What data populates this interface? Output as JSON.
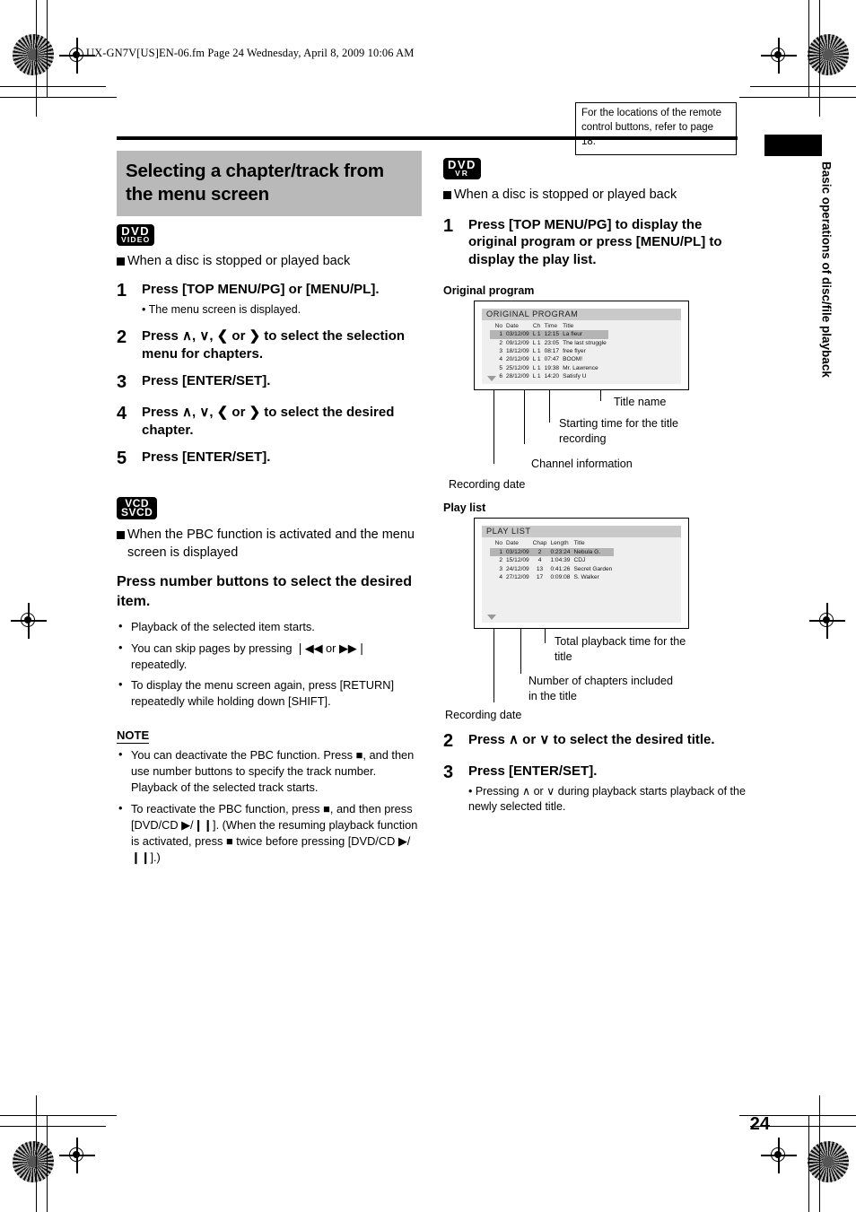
{
  "page": {
    "file_header": "UX-GN7V[US]EN-06.fm  Page 24  Wednesday, April 8, 2009  10:06 AM",
    "page_number": "24",
    "side_tab_label": "Basic operations of disc/file playback",
    "reference_note": "For the locations of the remote control buttons, refer to page 18."
  },
  "left_column": {
    "section_title": "Selecting a chapter/track from the menu screen",
    "dvd_badge": {
      "line1": "DVD",
      "line2": "VIDEO"
    },
    "condition": "When a disc is stopped or played back",
    "steps": [
      {
        "num": "1",
        "text": "Press [TOP MENU/PG] or [MENU/PL].",
        "sub": "• The menu screen is displayed."
      },
      {
        "num": "2",
        "text": "Press ∧, ∨, ❮ or ❯ to select the selection menu for chapters.",
        "sub": ""
      },
      {
        "num": "3",
        "text": "Press [ENTER/SET].",
        "sub": ""
      },
      {
        "num": "4",
        "text": "Press ∧, ∨, ❮ or ❯ to select the desired chapter.",
        "sub": ""
      },
      {
        "num": "5",
        "text": "Press [ENTER/SET].",
        "sub": ""
      }
    ],
    "vcd_badge": {
      "line1": "VCD",
      "line2": "SVCD"
    },
    "pbc_condition": "When the PBC function is activated and the menu screen is displayed",
    "pbc_instruction": "Press number buttons to select the desired item.",
    "pbc_bullets": [
      "Playback of the selected item starts.",
      "You can skip pages by pressing ❘◀◀ or ▶▶❘ repeatedly.",
      "To display the menu screen again, press [RETURN] repeatedly while holding down [SHIFT]."
    ],
    "note_header": "NOTE",
    "note_bullets": [
      "You can deactivate the PBC function. Press ■, and then use number buttons to specify the track number. Playback of the selected track starts.",
      "To reactivate the PBC function, press ■, and then press [DVD/CD ▶/❙❙]. (When the resuming playback function is activated, press ■ twice before pressing [DVD/CD ▶/❙❙].)"
    ]
  },
  "right_column": {
    "dvd_vr_badge": {
      "line1": "DVD",
      "line2": "VR"
    },
    "condition": "When a disc is stopped or played back",
    "steps": [
      {
        "num": "1",
        "text": "Press [TOP MENU/PG] to display the original program or press [MENU/PL] to display the play list.",
        "sub": ""
      },
      {
        "num": "2",
        "text": "Press ∧ or ∨ to select the desired title.",
        "sub": ""
      },
      {
        "num": "3",
        "text": "Press [ENTER/SET].",
        "sub": "• Pressing ∧ or ∨ during playback starts playback of the newly selected title."
      }
    ],
    "original_program": {
      "caption": "Original program",
      "osd_title": "ORIGINAL PROGRAM",
      "columns": [
        "No",
        "Date",
        "Ch",
        "Time",
        "Title"
      ],
      "rows": [
        {
          "no": "1",
          "date": "03/12/09",
          "ch": "L  1",
          "time": "12:15",
          "title": "La fleur",
          "selected": true
        },
        {
          "no": "2",
          "date": "09/12/09",
          "ch": "L  1",
          "time": "23:05",
          "title": "The last struggle",
          "selected": false
        },
        {
          "no": "3",
          "date": "18/12/09",
          "ch": "L  1",
          "time": "08:17",
          "title": "free flyer",
          "selected": false
        },
        {
          "no": "4",
          "date": "20/12/09",
          "ch": "L  1",
          "time": "07:47",
          "title": "BOOM!",
          "selected": false
        },
        {
          "no": "5",
          "date": "25/12/09",
          "ch": "L  1",
          "time": "19:38",
          "title": "Mr. Lawrence",
          "selected": false
        },
        {
          "no": "6",
          "date": "28/12/09",
          "ch": "L  1",
          "time": "14:20",
          "title": "Satisfy U",
          "selected": false
        }
      ],
      "callouts": [
        "Title name",
        "Starting time for the title recording",
        "Channel information",
        "Recording date"
      ]
    },
    "play_list": {
      "caption": "Play list",
      "osd_title": "PLAY LIST",
      "columns": [
        "No",
        "Date",
        "Chap",
        "Length",
        "Title"
      ],
      "rows": [
        {
          "no": "1",
          "date": "03/12/09",
          "chap": "2",
          "length": "0:23:24",
          "title": "Nebula G.",
          "selected": true
        },
        {
          "no": "2",
          "date": "15/12/09",
          "chap": "4",
          "length": "1:04:39",
          "title": "CDJ",
          "selected": false
        },
        {
          "no": "3",
          "date": "24/12/09",
          "chap": "13",
          "length": "0:41:26",
          "title": "Secret Garden",
          "selected": false
        },
        {
          "no": "4",
          "date": "27/12/09",
          "chap": "17",
          "length": "0:09:08",
          "title": "S. Walker",
          "selected": false
        }
      ],
      "callouts": [
        "Total playback time for the title",
        "Number of chapters included in the title",
        "Recording date"
      ]
    }
  }
}
